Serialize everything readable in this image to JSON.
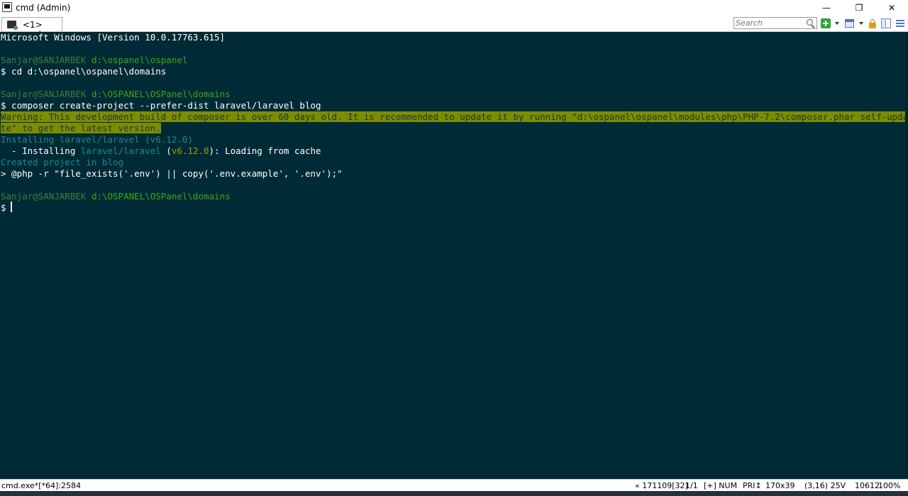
{
  "window": {
    "title": "cmd (Admin)",
    "min_glyph": "—",
    "max_glyph": "❐",
    "close_glyph": "✕"
  },
  "tabs": [
    {
      "label": "<1> cmd"
    }
  ],
  "search": {
    "placeholder": "Search"
  },
  "console": {
    "lines": {
      "l0": "Microsoft Windows [Version 10.0.17763.615]",
      "l2_user": "Sanjar@SANJARBEK",
      "l2_path": " d:\\ospanel\\ospanel",
      "l3": "$ cd d:\\ospanel\\ospanel\\domains",
      "l5_user": "Sanjar@SANJARBEK",
      "l5_path": " d:\\OSPANEL\\OSPanel\\domains",
      "l6": "$ composer create-project --prefer-dist laravel/laravel blog",
      "l7": "Warning: This development build of composer is over 60 days old. It is recommended to update it by running \"d:\\ospanel\\ospanel\\modules\\php\\PHP-7.2\\composer.phar self-upda",
      "l8": "te\" to get the latest version.",
      "l9": "Installing laravel/laravel (v6.12.0)",
      "l10_a": "  - Installing ",
      "l10_b": "laravel/laravel",
      "l10_c": " (",
      "l10_d": "v6.12.0",
      "l10_e": "): Loading from cache",
      "l11": "Created project in blog",
      "l12": "> @php -r \"file_exists('.env') || copy('.env.example', '.env');\"",
      "l14_user": "Sanjar@SANJARBEK",
      "l14_path": " d:\\OSPANEL\\OSPanel\\domains",
      "l15": "$ "
    }
  },
  "status": {
    "process": "cmd.exe*[*64]:2584",
    "s1": "« 171109[32]",
    "s2": "1/1",
    "s3": "[+] NUM",
    "s4": "PRI↕",
    "s5": "170x39",
    "s6": "(3,16) 25V",
    "s7": "10612",
    "s8": "100%"
  },
  "colors": {
    "background": "#002b36",
    "prompt_user": "#3e7f3c",
    "prompt_path": "#3ea51c",
    "info": "#1f8a8a",
    "warning_bg": "#7f8c00"
  }
}
